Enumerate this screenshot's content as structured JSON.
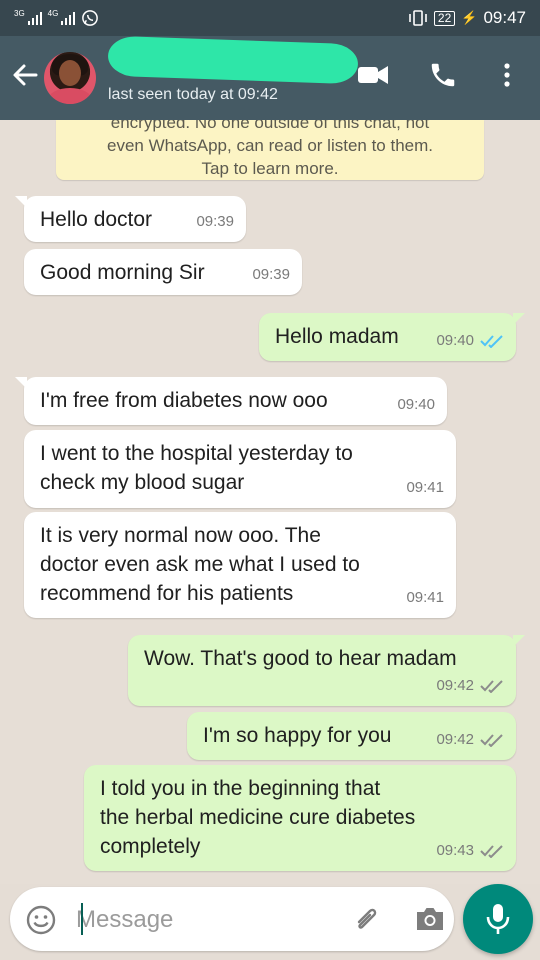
{
  "status_bar": {
    "network_1": "3G",
    "network_2": "4G",
    "battery": "22",
    "time": "09:47"
  },
  "header": {
    "last_seen": "last seen today at 09:42"
  },
  "encryption_notice": {
    "line_cut": "encrypted. No one outside of this chat, not",
    "line_2": "even WhatsApp, can read or listen to them.",
    "line_3": "Tap to learn more."
  },
  "messages": [
    {
      "direction": "in",
      "text": "Hello doctor",
      "time": "09:39"
    },
    {
      "direction": "in",
      "text": "Good morning Sir",
      "time": "09:39"
    },
    {
      "direction": "out",
      "text": "Hello madam",
      "time": "09:40",
      "status": "read"
    },
    {
      "direction": "in",
      "text": "I'm free from diabetes now ooo",
      "time": "09:40"
    },
    {
      "direction": "in",
      "text": "I went to the hospital yesterday to\ncheck my blood sugar",
      "time": "09:41"
    },
    {
      "direction": "in",
      "text": "It is very normal now ooo. The\ndoctor even ask me what I used to\nrecommend for his patients",
      "time": "09:41"
    },
    {
      "direction": "out",
      "text": "Wow. That's good to hear madam",
      "time": "09:42",
      "status": "delivered"
    },
    {
      "direction": "out",
      "text": "I'm so happy for you",
      "time": "09:42",
      "status": "delivered"
    },
    {
      "direction": "out",
      "text": "I told you in the beginning that\nthe herbal medicine cure diabetes\ncompletely",
      "time": "09:43",
      "status": "delivered"
    }
  ],
  "composer": {
    "placeholder": "Message"
  },
  "icons": {
    "back": "arrow-left-icon",
    "video": "video-camera-icon",
    "call": "phone-icon",
    "menu": "more-vertical-icon",
    "emoji": "emoji-icon",
    "attach": "paperclip-icon",
    "camera": "camera-icon",
    "mic": "microphone-icon"
  },
  "colors": {
    "app_bar": "#455a64",
    "status_bar": "#37474f",
    "chat_bg": "#e6ded6",
    "incoming_bubble": "#ffffff",
    "outgoing_bubble": "#dcf8c6",
    "read_ticks": "#4fc3f7",
    "delivered_ticks": "#8c8c8c",
    "accent": "#00897b"
  }
}
